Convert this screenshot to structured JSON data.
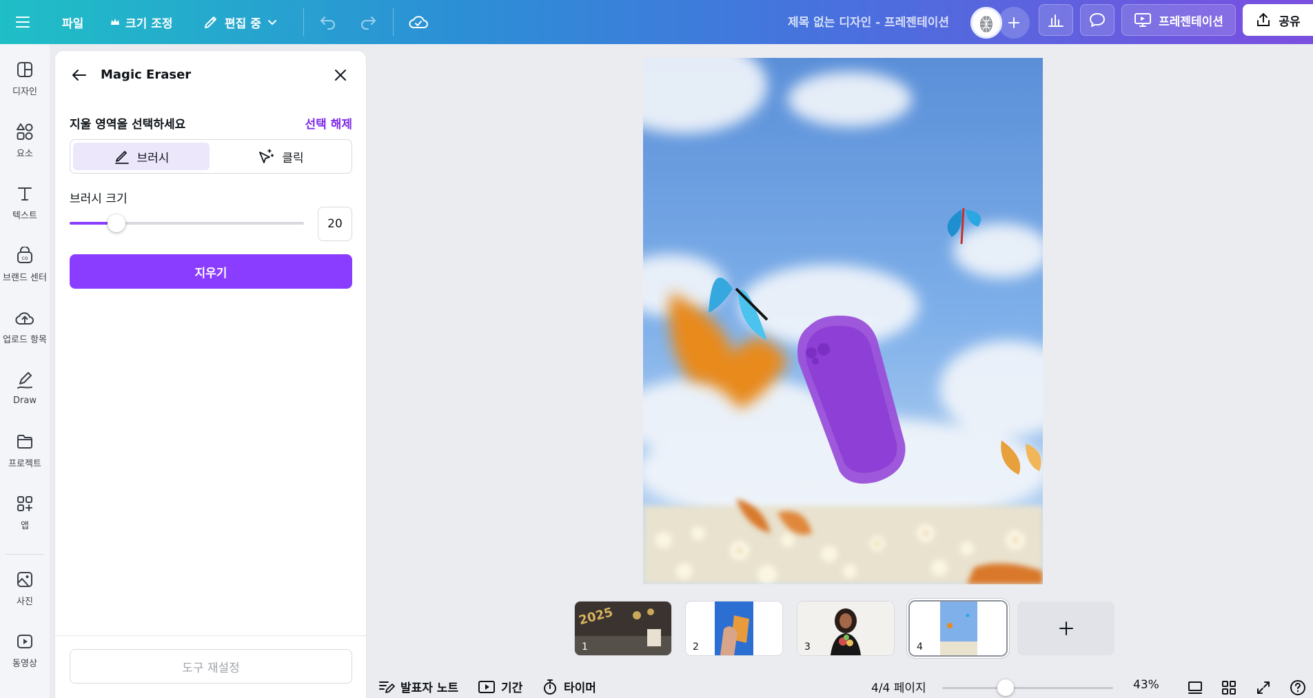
{
  "topbar": {
    "file_label": "파일",
    "resize_label": "크기 조정",
    "edit_mode_label": "편집 중",
    "design_title": "제목 없는 디자인 - 프레젠테이션",
    "present_label": "프레젠테이션",
    "share_label": "공유"
  },
  "rail": {
    "items": [
      {
        "label": "디자인",
        "icon": "design-icon"
      },
      {
        "label": "요소",
        "icon": "elements-icon"
      },
      {
        "label": "텍스트",
        "icon": "text-icon"
      },
      {
        "label": "브랜드 센터",
        "icon": "brand-icon"
      },
      {
        "label": "업로드 항목",
        "icon": "upload-icon"
      },
      {
        "label": "Draw",
        "icon": "draw-icon"
      },
      {
        "label": "프로젝트",
        "icon": "folder-icon"
      },
      {
        "label": "앱",
        "icon": "apps-icon"
      },
      {
        "label": "사진",
        "icon": "photo-icon"
      },
      {
        "label": "동영상",
        "icon": "video-icon"
      }
    ]
  },
  "panel": {
    "title": "Magic Eraser",
    "select_area_label": "지울 영역을 선택하세요",
    "deselect_label": "선택 해제",
    "mode_brush": "브러시",
    "mode_click": "클릭",
    "brush_size_label": "브러시 크기",
    "brush_size_value": "20",
    "brush_size_fraction": 0.2,
    "erase_button": "지우기",
    "reset_button": "도구 재설정"
  },
  "pages": {
    "thumbnails": [
      {
        "number": "1"
      },
      {
        "number": "2"
      },
      {
        "number": "3"
      },
      {
        "number": "4",
        "active": true
      }
    ],
    "add_label": "+"
  },
  "bottombar": {
    "notes_label": "발표자 노트",
    "duration_label": "기간",
    "timer_label": "타이머",
    "page_indicator": "4/4 페이지",
    "zoom_fraction": 0.37,
    "zoom_label": "43%"
  },
  "colors": {
    "accent": "#8b3dff",
    "link": "#7d2ae8",
    "topbar_start": "#1fbfc6",
    "topbar_end": "#7b4fe0"
  }
}
